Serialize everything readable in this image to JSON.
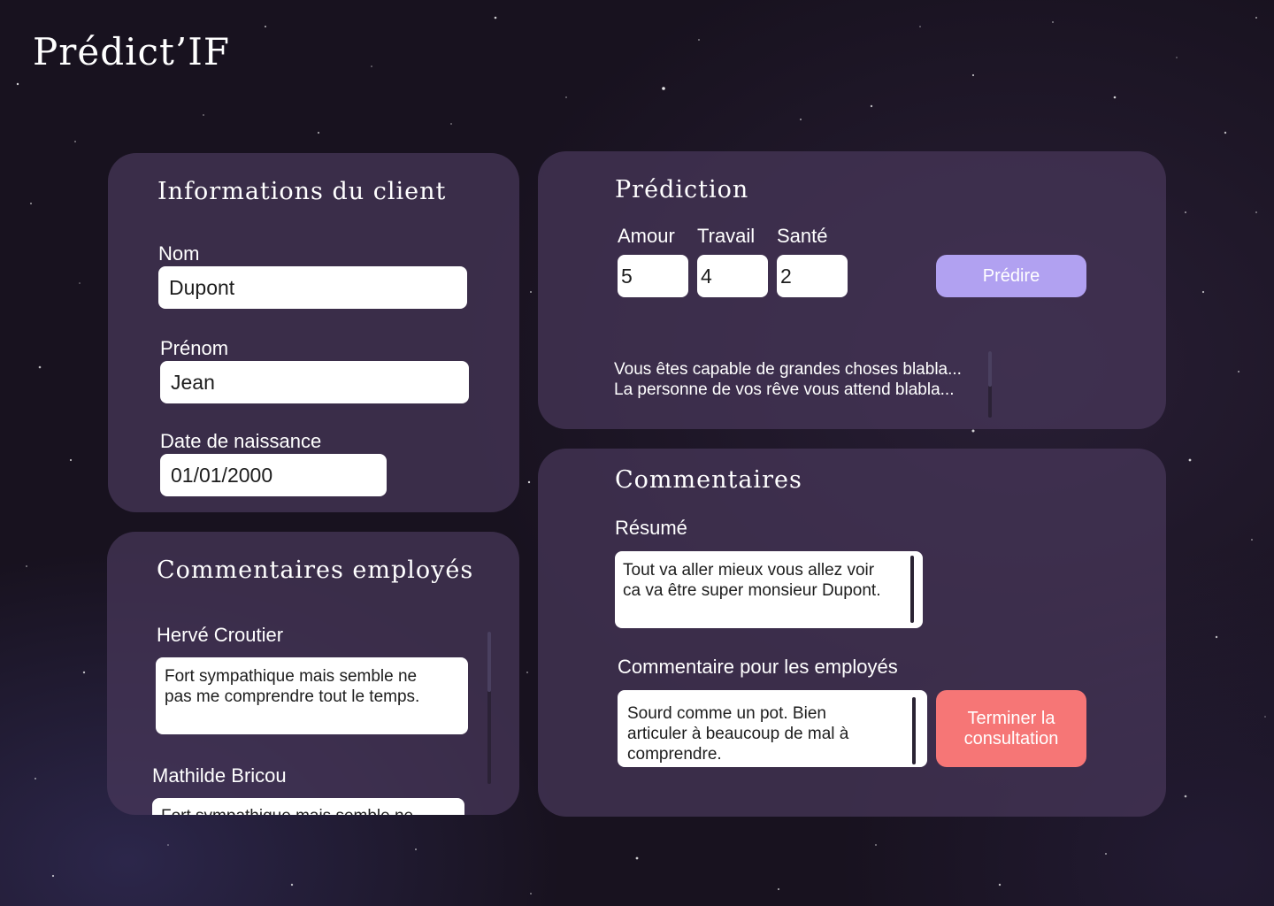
{
  "app": {
    "title": "Prédict’IF"
  },
  "client_info": {
    "title": "Informations du client",
    "nom_label": "Nom",
    "nom_value": "Dupont",
    "prenom_label": "Prénom",
    "prenom_value": "Jean",
    "date_label": "Date de naissance",
    "date_value": "01/01/2000"
  },
  "employee_comments": {
    "title": "Commentaires employés",
    "items": [
      {
        "author": "Hervé Croutier",
        "line1": "Fort sympathique mais semble ne",
        "line2": "pas me comprendre tout le temps."
      },
      {
        "author": "Mathilde Bricou",
        "line1": "Fort sympathique mais semble ne"
      }
    ]
  },
  "prediction": {
    "title": "Prédiction",
    "amour_label": "Amour",
    "amour_value": "5",
    "travail_label": "Travail",
    "travail_value": "4",
    "sante_label": "Santé",
    "sante_value": "2",
    "predict_button": "Prédire",
    "result_line1": "Vous êtes capable de grandes choses blabla...",
    "result_line2": "La personne de vos rêve vous attend blabla..."
  },
  "comments": {
    "title": "Commentaires",
    "summary_label": "Résumé",
    "summary_line1": "Tout va aller mieux vous allez voir",
    "summary_line2": "ca va être super monsieur Dupont.",
    "employee_label": "Commentaire pour les employés",
    "employee_line1": "Sourd comme un pot. Bien",
    "employee_line2": "articuler à beaucoup de mal à",
    "employee_line3": "comprendre.",
    "end_button_line1": "Terminer la",
    "end_button_line2": "consultation"
  },
  "colors": {
    "card_bg": "#48385A",
    "predict_button": "#B1A1F1",
    "end_button": "#F67676",
    "field_bg": "#FFFFFF"
  }
}
